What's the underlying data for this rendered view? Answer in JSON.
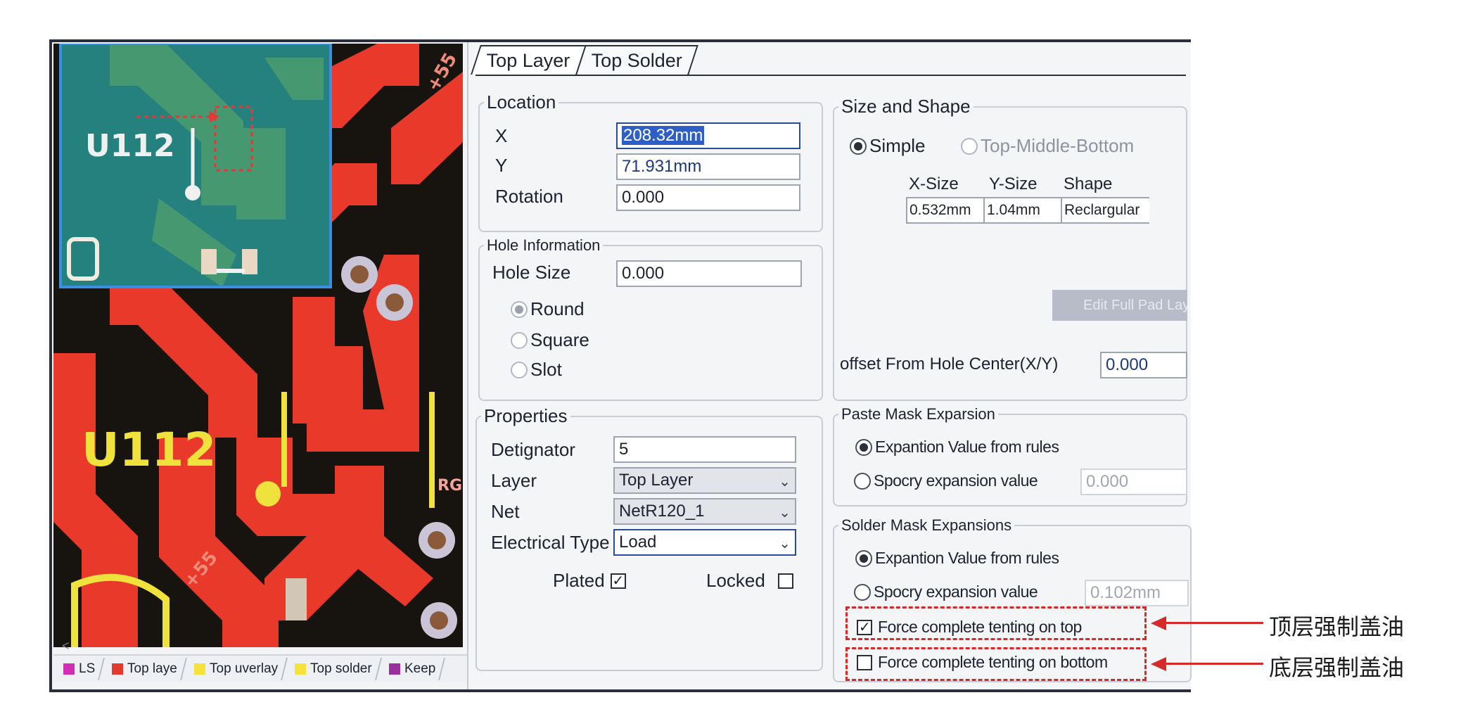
{
  "pcb": {
    "labels": {
      "component": "U112",
      "net_55": "+55",
      "r_prefix": "RG"
    }
  },
  "legend": [
    {
      "label": "LS",
      "color": "#d02fb5"
    },
    {
      "label": "Top laye",
      "color": "#e23b2e"
    },
    {
      "label": "Top uverlay",
      "color": "#f5e23a"
    },
    {
      "label": "Top solder",
      "color": "#8c4aa8"
    },
    {
      "label": "Keep",
      "color": "#9a2f9e"
    }
  ],
  "legend_scroll": "<",
  "tabs": [
    "Top Layer",
    "Top Solder"
  ],
  "location": {
    "title": "Location",
    "x_label": "X",
    "x_value": "208.32mm",
    "y_label": "Y",
    "y_value": "71.931mm",
    "rotation_label": "Rotation",
    "rotation_value": "0.000"
  },
  "hole": {
    "title": "Hole Information",
    "size_label": "Hole Size",
    "size_value": "0.000",
    "shapes": [
      "Round",
      "Square",
      "Slot"
    ]
  },
  "properties": {
    "title": "Properties",
    "designator_label": "Detignator",
    "designator_value": "5",
    "layer_label": "Layer",
    "layer_value": "Top Layer",
    "net_label": "Net",
    "net_value": "NetR120_1",
    "etype_label": "Electrical Type",
    "etype_value": "Load",
    "plated_label": "Plated",
    "plated_checked": true,
    "locked_label": "Locked",
    "locked_checked": false
  },
  "size_shape": {
    "title": "Size and Shape",
    "mode_simple": "Simple",
    "mode_tmb": "Top-Middle-Bottom",
    "col_x": "X-Size",
    "col_y": "Y-Size",
    "col_shape": "Shape",
    "x_value": "0.532mm",
    "y_value": "1.04mm",
    "shape_value": "Reclargular",
    "edit_button": "Edit Full Pad Layer De",
    "offset_label": "offset From Hole Center(X/Y)",
    "offset_value": "0.000"
  },
  "paste_mask": {
    "title": "Paste Mask Exparsion",
    "opt_rules": "Expantion Value from rules",
    "opt_specify": "Spocry expansion value",
    "specify_value": "0.000"
  },
  "solder_mask": {
    "title": "Solder Mask Expansions",
    "opt_rules": "Expantion Value from rules",
    "opt_specify": "Spocry expansion value",
    "specify_value": "0.102mm",
    "tent_top_label": "Force complete tenting on top",
    "tent_top_checked": true,
    "tent_bottom_label": "Force complete tenting on bottom",
    "tent_bottom_checked": false
  },
  "annotations": {
    "top": "顶层强制盖油",
    "bottom": "底层强制盖油",
    "color": "#d62a2a"
  }
}
